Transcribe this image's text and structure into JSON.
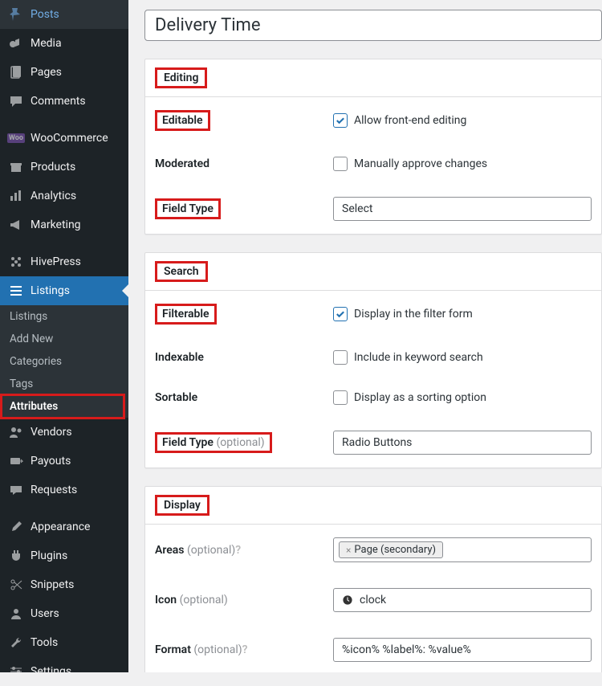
{
  "sidebar": {
    "items": [
      {
        "label": "Posts",
        "icon": "pin"
      },
      {
        "label": "Media",
        "icon": "media"
      },
      {
        "label": "Pages",
        "icon": "page"
      },
      {
        "label": "Comments",
        "icon": "comment"
      },
      {
        "label": "WooCommerce",
        "icon": "woo"
      },
      {
        "label": "Products",
        "icon": "archive"
      },
      {
        "label": "Analytics",
        "icon": "chart"
      },
      {
        "label": "Marketing",
        "icon": "megaphone"
      },
      {
        "label": "HivePress",
        "icon": "hive"
      },
      {
        "label": "Listings",
        "icon": "list",
        "active": true
      },
      {
        "label": "Vendors",
        "icon": "users"
      },
      {
        "label": "Payouts",
        "icon": "payout"
      },
      {
        "label": "Requests",
        "icon": "request"
      },
      {
        "label": "Appearance",
        "icon": "brush"
      },
      {
        "label": "Plugins",
        "icon": "plug"
      },
      {
        "label": "Snippets",
        "icon": "scissors"
      },
      {
        "label": "Users",
        "icon": "person"
      },
      {
        "label": "Tools",
        "icon": "wrench"
      },
      {
        "label": "Settings",
        "icon": "sliders"
      }
    ],
    "submenu": [
      "Listings",
      "Add New",
      "Categories",
      "Tags",
      "Attributes"
    ]
  },
  "title_value": "Delivery Time",
  "editing": {
    "heading": "Editing",
    "editable_label": "Editable",
    "editable_desc": "Allow front-end editing",
    "editable_checked": true,
    "moderated_label": "Moderated",
    "moderated_desc": "Manually approve changes",
    "moderated_checked": false,
    "fieldtype_label": "Field Type",
    "fieldtype_value": "Select"
  },
  "search": {
    "heading": "Search",
    "filterable_label": "Filterable",
    "filterable_desc": "Display in the filter form",
    "filterable_checked": true,
    "indexable_label": "Indexable",
    "indexable_desc": "Include in keyword search",
    "indexable_checked": false,
    "sortable_label": "Sortable",
    "sortable_desc": "Display as a sorting option",
    "sortable_checked": false,
    "fieldtype_label": "Field Type",
    "fieldtype_opt": "(optional)",
    "fieldtype_value": "Radio Buttons"
  },
  "display": {
    "heading": "Display",
    "areas_label": "Areas",
    "areas_opt": "(optional)",
    "areas_tag": "Page (secondary)",
    "areas_tag_x": "×",
    "icon_label": "Icon",
    "icon_opt": "(optional)",
    "icon_value": "clock",
    "format_label": "Format",
    "format_opt": "(optional)",
    "format_value": "%icon% %label%: %value%"
  }
}
